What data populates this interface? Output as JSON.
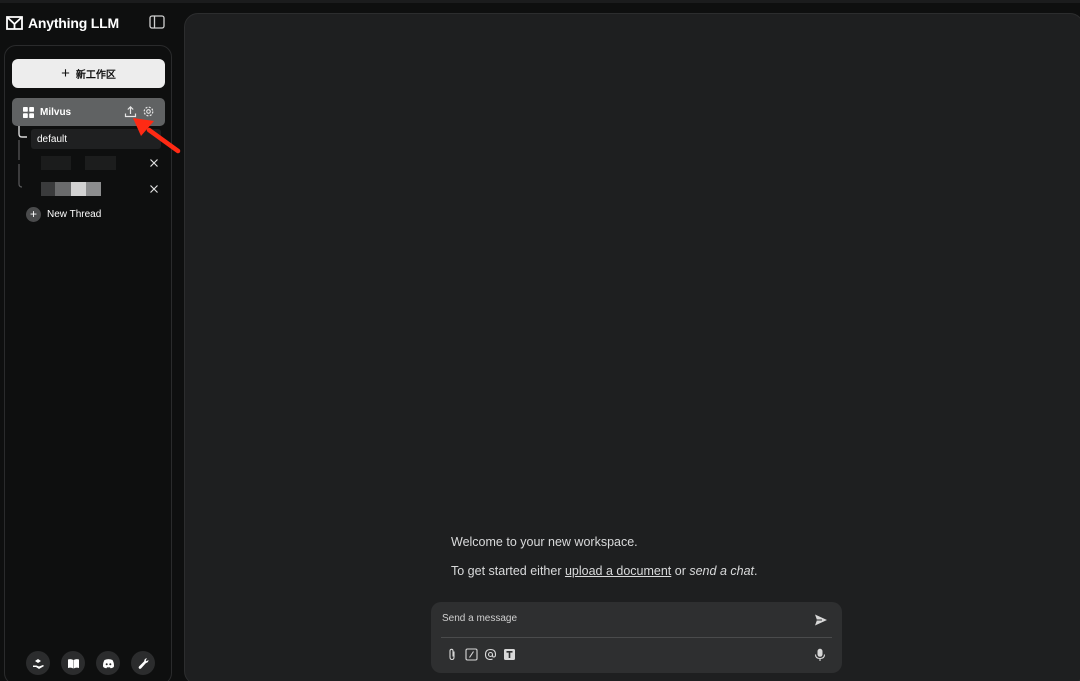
{
  "app": {
    "title": "Anything LLM"
  },
  "sidebar": {
    "new_workspace_label": "新工作区",
    "workspace": {
      "name": "Milvus"
    },
    "threads": {
      "default_label": "default",
      "new_thread_label": "New Thread"
    },
    "footer_icons": [
      "community-hub-icon",
      "docs-book-icon",
      "discord-icon",
      "settings-wrench-icon"
    ]
  },
  "main": {
    "welcome_text": "Welcome to your new workspace.",
    "get_started_prefix": "To get started either ",
    "upload_link": "upload a document",
    "or_text": " or ",
    "send_chat": "send a chat",
    "period": "."
  },
  "composer": {
    "placeholder": "Send a message",
    "tools": [
      "attach-icon",
      "slash-command-icon",
      "at-mention-icon",
      "text-format-icon"
    ]
  },
  "colors": {
    "background": "#0e0f0f",
    "main_panel": "#1e1f20",
    "workspace_active": "#606263",
    "new_workspace_button": "#ededed",
    "annotation_arrow": "#ff2a14"
  }
}
